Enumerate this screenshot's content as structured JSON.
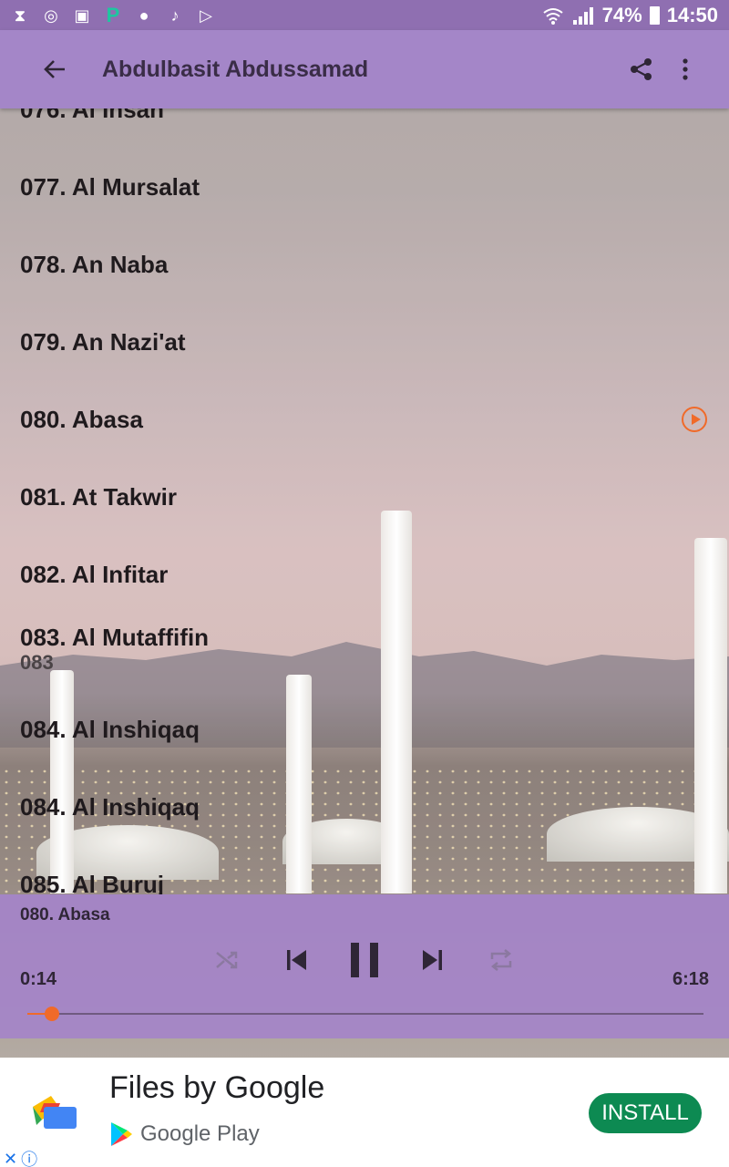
{
  "status_bar": {
    "icons": [
      "hourglass-icon",
      "sync-icon",
      "image-icon",
      "p-app-icon",
      "messenger-icon",
      "music-icon",
      "play-store-icon"
    ],
    "battery_percent": "74%",
    "time": "14:50"
  },
  "app_bar": {
    "title": "Abdulbasit Abdussamad",
    "back_icon": "arrow-back-icon",
    "share_icon": "share-icon",
    "more_icon": "more-vert-icon"
  },
  "list": {
    "items": [
      {
        "title": "076. Al Insan"
      },
      {
        "title": "077. Al Mursalat"
      },
      {
        "title": "078. An Naba"
      },
      {
        "title": "079. An Nazi'at"
      },
      {
        "title": "080. Abasa",
        "playing": true
      },
      {
        "title": "081. At Takwir"
      },
      {
        "title": "082. Al Infitar"
      },
      {
        "title": "083. Al Mutaffifin",
        "subtitle": "083"
      },
      {
        "title": "084. Al Inshiqaq"
      },
      {
        "title": "084. Al Inshiqaq"
      },
      {
        "title": "085. Al Buruj"
      }
    ]
  },
  "player": {
    "now_playing": "080. Abasa",
    "current_time": "0:14",
    "duration": "6:18",
    "progress": 0.037,
    "accent_color": "#f06a29"
  },
  "ad": {
    "title": "Files by Google",
    "store": "Google Play",
    "install_label": "INSTALL",
    "install_color": "#0d8a52"
  }
}
